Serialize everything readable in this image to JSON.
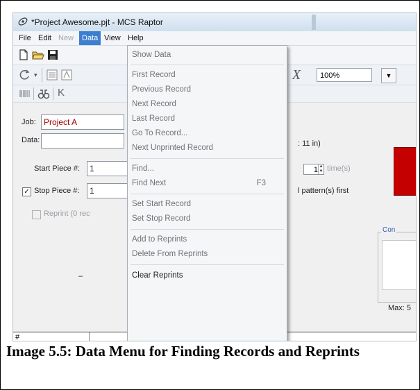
{
  "window": {
    "title": "*Project Awesome.pjt - MCS Raptor"
  },
  "menubar": {
    "items": [
      "File",
      "Edit",
      "New",
      "Data",
      "View",
      "Help"
    ]
  },
  "toolbar": {
    "zoom_value": "100%",
    "x_symbol": "X",
    "k_symbol": "K"
  },
  "form": {
    "job_label": "Job:",
    "job_value": "Project A",
    "data_label": "Data:",
    "start_piece_label": "Start Piece #:",
    "start_piece_value": "1",
    "stop_piece_label": "Stop Piece #:",
    "stop_piece_value": "1",
    "stop_piece_checked": "✓",
    "reprint_label": "Reprint (0 rec",
    "size_note": ": 11 in)",
    "copies_value": "1",
    "copies_unit": "time(s)",
    "pattern_note": "l pattern(s) first",
    "group_title": "Con",
    "max_label": "Max: 5",
    "dash": "–"
  },
  "grid": {
    "headers": [
      "#"
    ]
  },
  "data_menu": {
    "items": [
      {
        "label": "Show Data",
        "shortcut": ""
      },
      {
        "label": "First Record",
        "shortcut": ""
      },
      {
        "label": "Previous Record",
        "shortcut": ""
      },
      {
        "label": "Next Record",
        "shortcut": ""
      },
      {
        "label": "Last Record",
        "shortcut": ""
      },
      {
        "label": "Go To Record...",
        "shortcut": ""
      },
      {
        "label": "Next Unprinted Record",
        "shortcut": ""
      },
      {
        "label": "Find...",
        "shortcut": ""
      },
      {
        "label": "Find Next",
        "shortcut": "F3"
      },
      {
        "label": "Set Start Record",
        "shortcut": ""
      },
      {
        "label": "Set Stop Record",
        "shortcut": ""
      },
      {
        "label": "Add to Reprints",
        "shortcut": ""
      },
      {
        "label": "Delete From Reprints",
        "shortcut": ""
      },
      {
        "label": "Clear Reprints",
        "shortcut": ""
      }
    ]
  },
  "caption": "Image 5.5: Data Menu for Finding Records and Reprints"
}
